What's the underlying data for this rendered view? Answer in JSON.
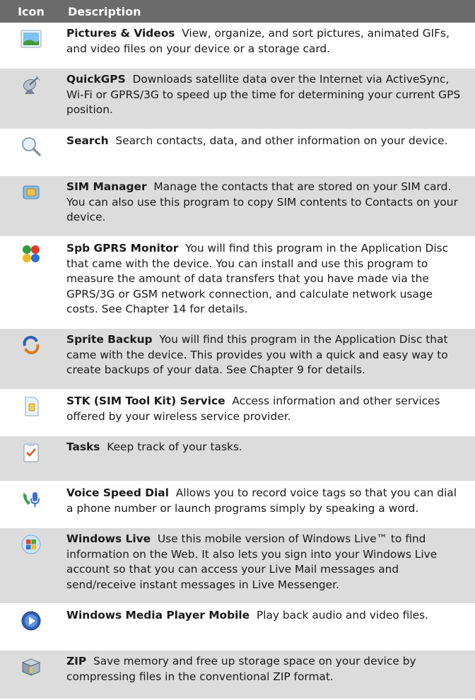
{
  "header": {
    "icon_col": "Icon",
    "desc_col": "Description"
  },
  "rows": [
    {
      "icon": "pictures-videos-icon",
      "title": "Pictures & Videos",
      "text": "View, organize, and sort pictures, animated GIFs, and video files on your device or a storage card."
    },
    {
      "icon": "quickgps-satellite-icon",
      "title": "QuickGPS",
      "text": "Downloads satellite data over the Internet via ActiveSync, Wi-Fi or GPRS/3G to speed up the time for determining your current GPS position."
    },
    {
      "icon": "search-magnifier-icon",
      "title": "Search",
      "text": "Search contacts, data, and other information on your device."
    },
    {
      "icon": "sim-manager-icon",
      "title": "SIM Manager",
      "text": "Manage the contacts that are stored on your SIM card. You can also use this program to copy SIM contents to Contacts on your device."
    },
    {
      "icon": "spb-gprs-monitor-icon",
      "title": "Spb GPRS Monitor",
      "text": "You will find this program in the Application Disc that came with the device. You can install and use this program to measure the amount of data transfers that you have made via the GPRS/3G or GSM network connection, and calculate network usage costs. See Chapter 14 for details."
    },
    {
      "icon": "sprite-backup-icon",
      "title": "Sprite Backup",
      "text": "You will find this program in the Application Disc that came with the device. This provides you with a quick and easy way to create backups of your data. See Chapter 9 for details."
    },
    {
      "icon": "stk-sim-card-icon",
      "title": "STK (SIM Tool Kit) Service",
      "text": "Access information and other services offered by your wireless service provider."
    },
    {
      "icon": "tasks-clipboard-icon",
      "title": "Tasks",
      "text": "Keep track of your tasks."
    },
    {
      "icon": "voice-speed-dial-icon",
      "title": "Voice Speed Dial",
      "text": "Allows you to record voice tags so that you can dial a phone number or launch programs simply by speaking a word."
    },
    {
      "icon": "windows-live-icon",
      "title": "Windows Live",
      "text": "Use this mobile version of Windows Live™ to find information on the Web. It also lets you sign into your Windows Live account so that you can access your Live Mail messages and send/receive instant messages in Live Messenger."
    },
    {
      "icon": "windows-media-player-icon",
      "title": "Windows Media Player Mobile",
      "text": "Play back audio and video files."
    },
    {
      "icon": "zip-archive-icon",
      "title": "ZIP",
      "text": "Save memory and free up storage space on your device by compressing files in the conventional ZIP format."
    }
  ]
}
